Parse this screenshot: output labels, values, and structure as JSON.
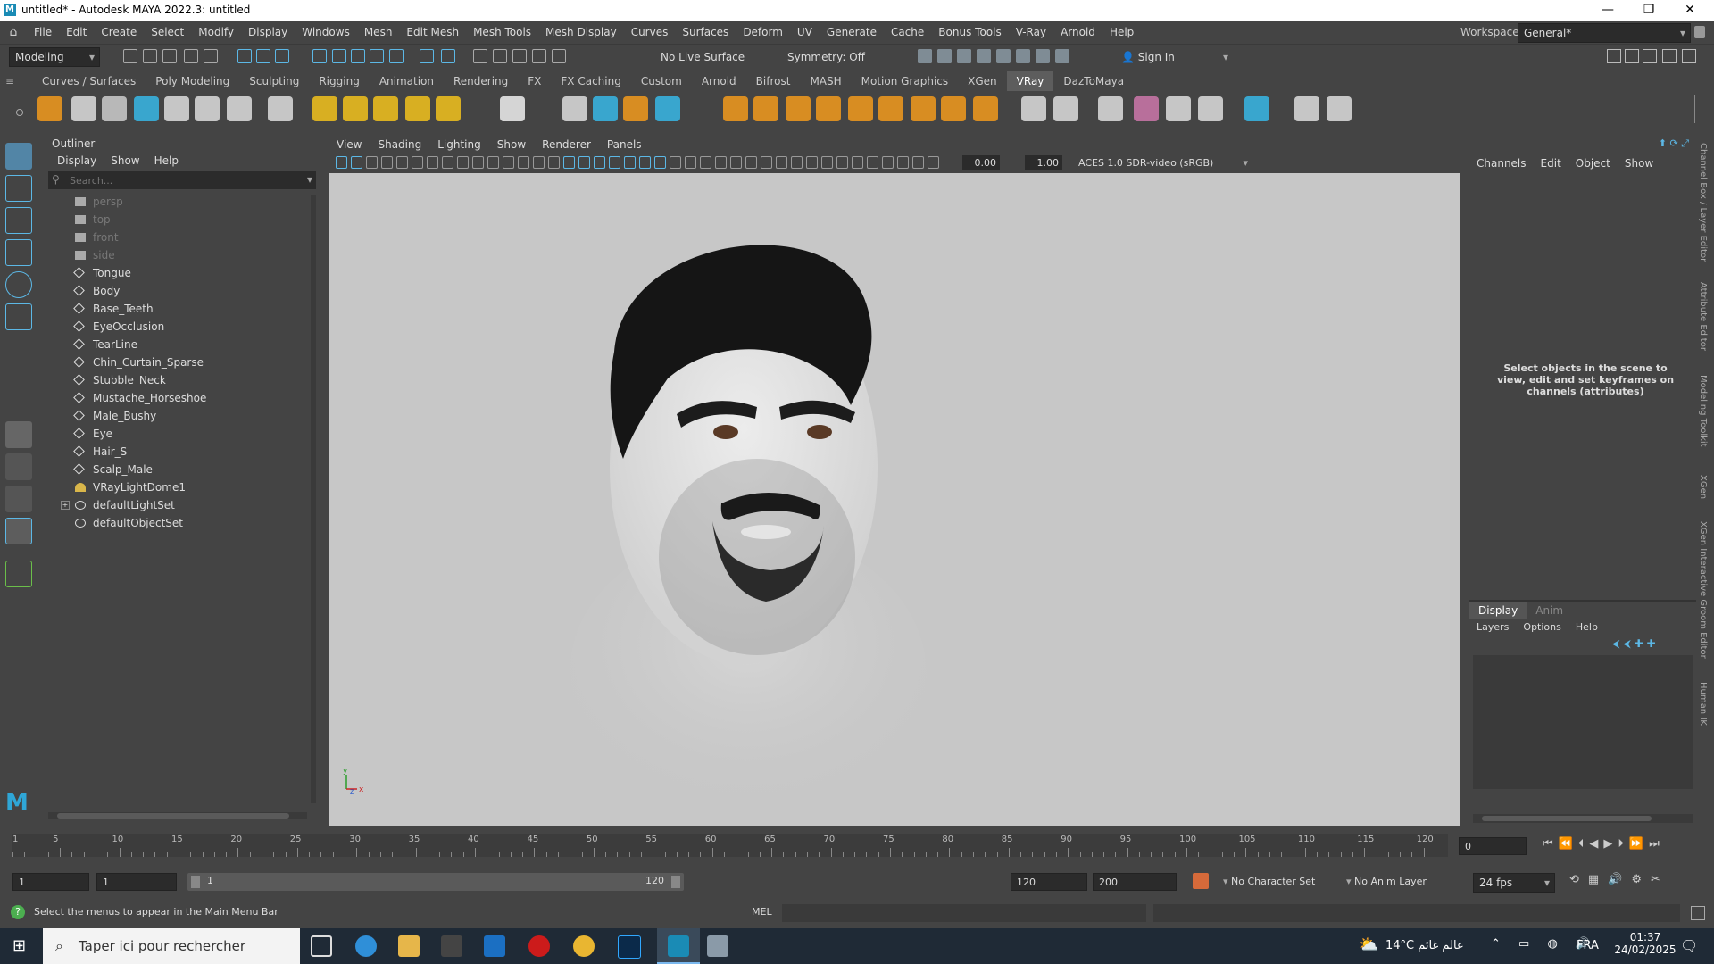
{
  "window": {
    "title": "untitled* - Autodesk MAYA 2022.3: untitled",
    "logo": "M",
    "minimize": "—",
    "maximize": "❐",
    "close": "✕"
  },
  "menubar": {
    "items": [
      "File",
      "Edit",
      "Create",
      "Select",
      "Modify",
      "Display",
      "Windows",
      "Mesh",
      "Edit Mesh",
      "Mesh Tools",
      "Mesh Display",
      "Curves",
      "Surfaces",
      "Deform",
      "UV",
      "Generate",
      "Cache",
      "Bonus Tools",
      "V-Ray",
      "Arnold",
      "Help"
    ],
    "workspace_label": "Workspace:",
    "workspace_value": "General*"
  },
  "statusline": {
    "mode": "Modeling",
    "live_surface": "No Live Surface",
    "symmetry": "Symmetry: Off",
    "sign_in": "Sign In"
  },
  "shelf": {
    "tabs": [
      "Curves / Surfaces",
      "Poly Modeling",
      "Sculpting",
      "Rigging",
      "Animation",
      "Rendering",
      "FX",
      "FX Caching",
      "Custom",
      "Arnold",
      "Bifrost",
      "MASH",
      "Motion Graphics",
      "XGen",
      "VRay",
      "DazToMaya"
    ],
    "active_tab": "VRay"
  },
  "outliner": {
    "title": "Outliner",
    "menu": [
      "Display",
      "Show",
      "Help"
    ],
    "search_placeholder": "Search...",
    "items": [
      {
        "label": "persp",
        "type": "camera",
        "dim": true
      },
      {
        "label": "top",
        "type": "camera",
        "dim": true
      },
      {
        "label": "front",
        "type": "camera",
        "dim": true
      },
      {
        "label": "side",
        "type": "camera",
        "dim": true
      },
      {
        "label": "Tongue",
        "type": "mesh",
        "dim": false
      },
      {
        "label": "Body",
        "type": "mesh",
        "dim": false
      },
      {
        "label": "Base_Teeth",
        "type": "mesh",
        "dim": false
      },
      {
        "label": "EyeOcclusion",
        "type": "mesh",
        "dim": false
      },
      {
        "label": "TearLine",
        "type": "mesh",
        "dim": false
      },
      {
        "label": "Chin_Curtain_Sparse",
        "type": "mesh",
        "dim": false
      },
      {
        "label": "Stubble_Neck",
        "type": "mesh",
        "dim": false
      },
      {
        "label": "Mustache_Horseshoe",
        "type": "mesh",
        "dim": false
      },
      {
        "label": "Male_Bushy",
        "type": "mesh",
        "dim": false
      },
      {
        "label": "Eye",
        "type": "mesh",
        "dim": false
      },
      {
        "label": "Hair_S",
        "type": "mesh",
        "dim": false
      },
      {
        "label": "Scalp_Male",
        "type": "mesh",
        "dim": false
      },
      {
        "label": "VRayLightDome1",
        "type": "light",
        "dim": false
      },
      {
        "label": "defaultLightSet",
        "type": "set",
        "dim": false
      },
      {
        "label": "defaultObjectSet",
        "type": "set",
        "dim": false
      }
    ]
  },
  "viewport": {
    "menu": [
      "View",
      "Shading",
      "Lighting",
      "Show",
      "Renderer",
      "Panels"
    ],
    "exposure": "0.00",
    "gamma": "1.00",
    "color_space": "ACES 1.0 SDR-video (sRGB)",
    "axis_x": "x",
    "axis_y": "y",
    "axis_z": "z"
  },
  "channelbox": {
    "menu": [
      "Channels",
      "Edit",
      "Object",
      "Show"
    ],
    "empty_message": "Select objects in the scene to view, edit and set keyframes on channels (attributes)",
    "layer_tabs": [
      "Display",
      "Anim"
    ],
    "layer_menu": [
      "Layers",
      "Options",
      "Help"
    ]
  },
  "right_strip_tabs": [
    "Channel Box / Layer Editor",
    "Attribute Editor",
    "Modeling Toolkit",
    "XGen",
    "XGen Interactive Groom Editor",
    "Human IK"
  ],
  "timeline": {
    "ticks": [
      "5",
      "10",
      "15",
      "20",
      "25",
      "30",
      "35",
      "40",
      "45",
      "50",
      "55",
      "60",
      "65",
      "70",
      "75",
      "80",
      "85",
      "90",
      "95",
      "100",
      "105",
      "110",
      "115",
      "120"
    ],
    "tick_start": "1",
    "current_frame": "0"
  },
  "range": {
    "start": "1",
    "playback_start": "1",
    "slider_start": "1",
    "slider_end": "120",
    "playback_end": "120",
    "end": "200",
    "character_set": "No Character Set",
    "anim_layer": "No Anim Layer",
    "fps": "24 fps"
  },
  "cmdline": {
    "help_text": "Select the menus to appear in the Main Menu Bar",
    "mel_label": "MEL"
  },
  "taskbar": {
    "search_placeholder": "Taper ici pour rechercher",
    "weather": "14°C عالم غائم",
    "language": "FRA",
    "time": "01:37",
    "date": "24/02/2025"
  },
  "colors": {
    "accent_blue": "#5cb8e6",
    "panel": "#444444",
    "viewport_bg": "#c7c7c7"
  }
}
